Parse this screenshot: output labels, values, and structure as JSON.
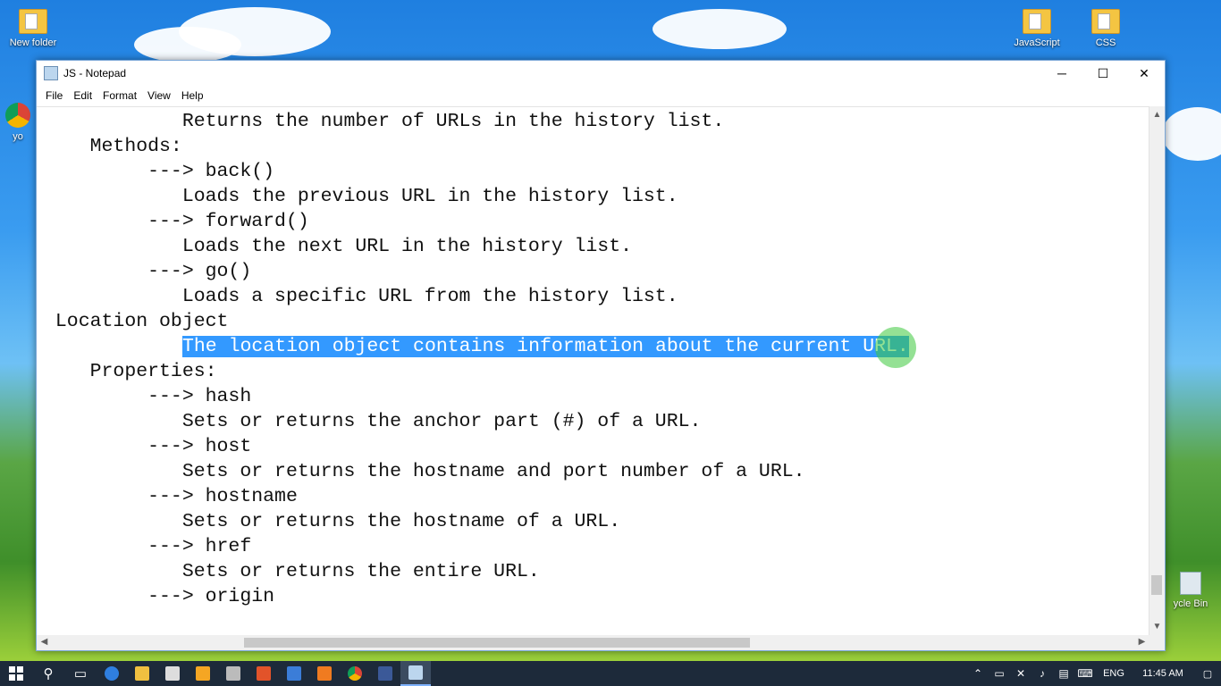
{
  "desktop": {
    "icons": [
      {
        "label": "New folder"
      },
      {
        "label": "JavaScript"
      },
      {
        "label": "CSS"
      },
      {
        "label": "ycle Bin"
      },
      {
        "label": "yo"
      }
    ]
  },
  "window": {
    "title": "JS - Notepad",
    "controls": {
      "minimize": "─",
      "maximize": "☐",
      "close": "✕"
    },
    "menu": [
      "File",
      "Edit",
      "Format",
      "View",
      "Help"
    ]
  },
  "editor": {
    "lines": [
      "            Returns the number of URLs in the history list.",
      "    Methods:",
      "         ---> back()",
      "            Loads the previous URL in the history list.",
      "         ---> forward()",
      "            Loads the next URL in the history list.",
      "         ---> go()",
      "            Loads a specific URL from the history list.",
      " Location object",
      "         ",
      "    Properties:",
      "         ---> hash",
      "            Sets or returns the anchor part (#) of a URL.",
      "         ---> host",
      "            Sets or returns the hostname and port number of a URL.",
      "         ---> hostname",
      "            Sets or returns the hostname of a URL.",
      "         ---> href",
      "            Sets or returns the entire URL.",
      "         ---> origin"
    ],
    "selected_text": "The location object contains information about the current URL.",
    "selection_color": "#3399ff"
  },
  "taskbar": {
    "language": "ENG",
    "time": "11:45 AM"
  }
}
